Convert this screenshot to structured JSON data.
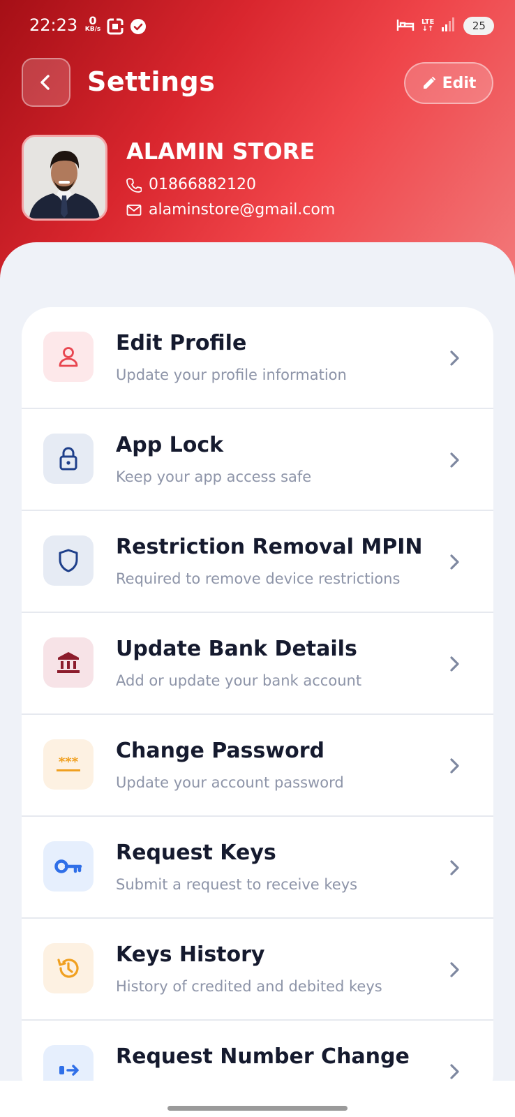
{
  "status_bar": {
    "time": "22:23",
    "net_speed_value": "0",
    "net_speed_unit": "KB/s",
    "network": "LTE",
    "battery": "25"
  },
  "header": {
    "title": "Settings",
    "edit_label": "Edit",
    "profile": {
      "name": "ALAMIN STORE",
      "phone": "01866882120",
      "email": "alaminstore@gmail.com"
    }
  },
  "colors": {
    "header_gradient_start": "#a50f16",
    "header_gradient_end": "#f27a7b",
    "page_background": "#eff2f8",
    "title_text": "#151a2e",
    "subtitle_text": "#8d94a8"
  },
  "settings": [
    {
      "title": "Edit Profile",
      "subtitle": "Update your profile information",
      "icon": "user-icon",
      "icon_bg": "#fde8ea",
      "icon_color": "#e8454f"
    },
    {
      "title": "App Lock",
      "subtitle": "Keep your app access safe",
      "icon": "lock-icon",
      "icon_bg": "#e6ebf4",
      "icon_color": "#1e3f8a"
    },
    {
      "title": "Restriction Removal MPIN",
      "subtitle": "Required to remove device restrictions",
      "icon": "shield-icon",
      "icon_bg": "#e6ebf4",
      "icon_color": "#1e3f8a"
    },
    {
      "title": "Update Bank Details",
      "subtitle": "Add or update your bank account",
      "icon": "bank-icon",
      "icon_bg": "#f7e3e7",
      "icon_color": "#8c1c2c"
    },
    {
      "title": "Change Password",
      "subtitle": "Update your account password",
      "icon": "password-icon",
      "icon_bg": "#fdf1e2",
      "icon_color": "#f0a020"
    },
    {
      "title": "Request Keys",
      "subtitle": "Submit a request to receive keys",
      "icon": "key-icon",
      "icon_bg": "#e6effd",
      "icon_color": "#2f6fe8"
    },
    {
      "title": "Keys History",
      "subtitle": "History of credited and debited keys",
      "icon": "history-icon",
      "icon_bg": "#fdf1e2",
      "icon_color": "#f0a020"
    },
    {
      "title": "Request Number Change",
      "subtitle": "",
      "icon": "transfer-icon",
      "icon_bg": "#e6effd",
      "icon_color": "#2f6fe8"
    }
  ]
}
